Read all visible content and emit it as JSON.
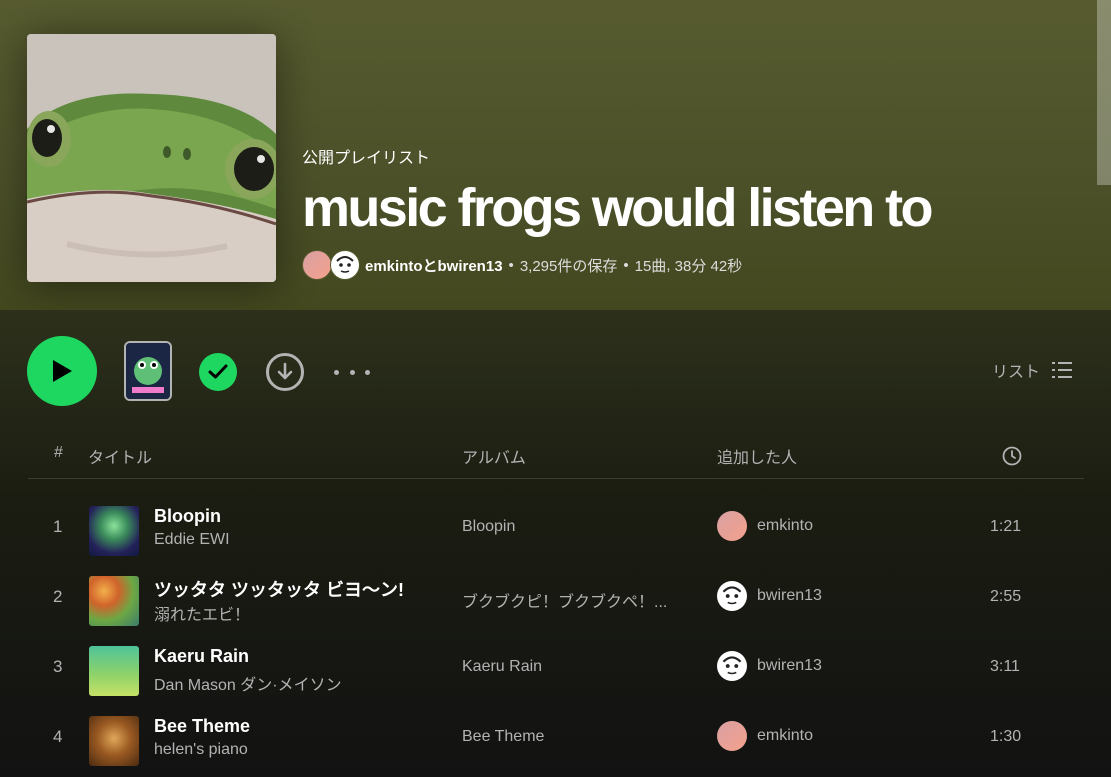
{
  "playlist": {
    "type_label": "公開プレイリスト",
    "title": "music frogs would listen to",
    "owners": "emkintoとbwiren13",
    "saves": "3,295件の保存",
    "track_count": "15曲",
    "duration": "38分 42秒",
    "meta_separator": "•"
  },
  "controls": {
    "view_label": "リスト"
  },
  "table": {
    "headers": {
      "num": "#",
      "title": "タイトル",
      "album": "アルバム",
      "added_by": "追加した人"
    }
  },
  "tracks": [
    {
      "num": "1",
      "title": "Bloopin",
      "artist": "Eddie EWI",
      "album": "Bloopin",
      "added_by": "emkinto",
      "duration": "1:21"
    },
    {
      "num": "2",
      "title": "ツッタタ ツッタッタ ビヨ〜ン!",
      "artist": "溺れたエビ！",
      "album": "ブクブクピ！ブクブクペ！...",
      "added_by": "bwiren13",
      "duration": "2:55"
    },
    {
      "num": "3",
      "title": "Kaeru Rain",
      "artist": "Dan Mason ダン·メイソン",
      "album": "Kaeru Rain",
      "added_by": "bwiren13",
      "duration": "3:11"
    },
    {
      "num": "4",
      "title": "Bee Theme",
      "artist": "helen's piano",
      "album": "Bee Theme",
      "added_by": "emkinto",
      "duration": "1:30"
    }
  ],
  "colors": {
    "accent": "#1ed760",
    "header_bg": "#575b2f",
    "background": "#121212"
  }
}
